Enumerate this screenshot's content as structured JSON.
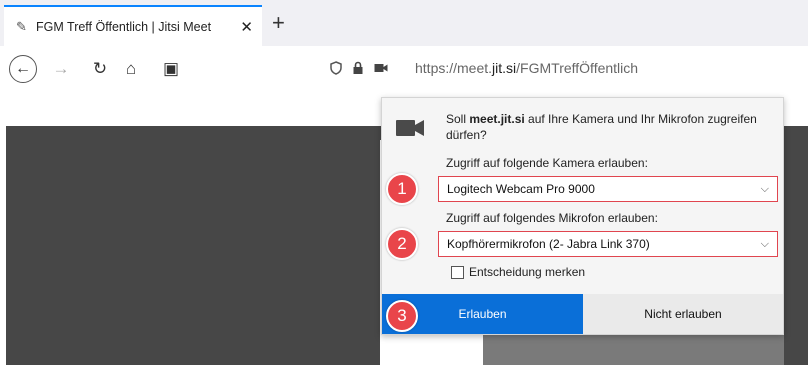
{
  "tab": {
    "title": "FGM Treff Öffentlich | Jitsi Meet",
    "close": "✕",
    "new_tab": "+"
  },
  "navbar": {
    "back": "←",
    "forward": "→",
    "reload": "↻",
    "home": "⌂",
    "reader": "▣",
    "url_prefix": "https://meet.",
    "url_domain": "jit.si",
    "url_path": "/FGMTreffÖffentlich"
  },
  "panel": {
    "question_pre": "Soll ",
    "question_domain": "meet.jit.si",
    "question_post": " auf Ihre Kamera und Ihr Mikrofon zugreifen dürfen?",
    "camera_label": "Zugriff auf folgende Kamera erlauben:",
    "camera_value": "Logitech Webcam Pro 9000",
    "mic_label": "Zugriff auf folgendes Mikrofon erlauben:",
    "mic_value": "Kopfhörermikrofon (2- Jabra Link 370)",
    "remember_label": "Entscheidung merken",
    "allow_label": "Erlauben",
    "deny_label": "Nicht erlauben"
  },
  "badges": [
    "1",
    "2",
    "3"
  ],
  "colors": {
    "accent": "#0a6fd8",
    "badge": "#e9454a",
    "highlight_border": "#e0454f"
  },
  "icons": [
    "favicon-icon",
    "close-icon",
    "plus-icon",
    "back-icon",
    "forward-icon",
    "reload-icon",
    "home-icon",
    "reader-icon",
    "shield-icon",
    "lock-icon",
    "camera-icon",
    "chevron-down-icon"
  ]
}
